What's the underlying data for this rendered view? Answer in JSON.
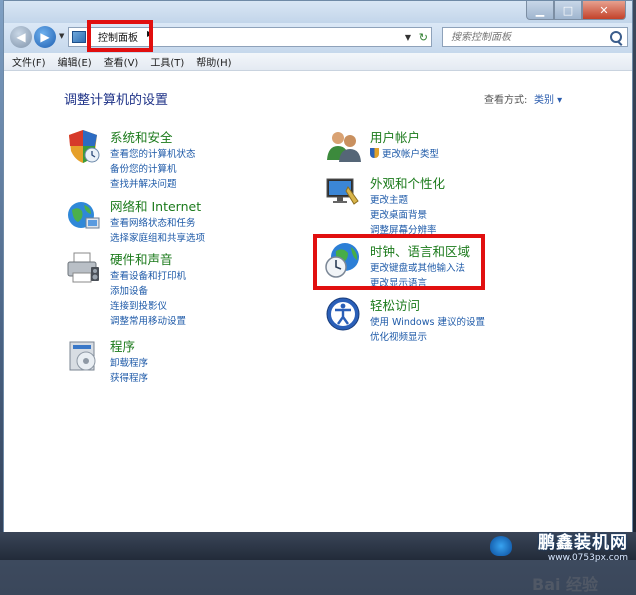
{
  "window": {
    "minimize_icon": "minimize-icon",
    "maximize_icon": "maximize-icon",
    "close_icon": "close-icon"
  },
  "navigation": {
    "breadcrumb": "控制面板",
    "search_placeholder": "搜索控制面板"
  },
  "menu": [
    "文件(F)",
    "编辑(E)",
    "查看(V)",
    "工具(T)",
    "帮助(H)"
  ],
  "content": {
    "heading": "调整计算机的设置",
    "view_by_label": "查看方式:",
    "view_by_value": "类别 ▾"
  },
  "categories_left": [
    {
      "id": "system-security",
      "title": "系统和安全",
      "icon": "shield-icon",
      "links": [
        "查看您的计算机状态",
        "备份您的计算机",
        "查找并解决问题"
      ]
    },
    {
      "id": "network-internet",
      "title": "网络和 Internet",
      "icon": "network-globe-icon",
      "links": [
        "查看网络状态和任务",
        "选择家庭组和共享选项"
      ]
    },
    {
      "id": "hardware-sound",
      "title": "硬件和声音",
      "icon": "printer-icon",
      "links": [
        "查看设备和打印机",
        "添加设备",
        "连接到投影仪",
        "调整常用移动设置"
      ]
    },
    {
      "id": "programs",
      "title": "程序",
      "icon": "programs-icon",
      "links": [
        "卸载程序",
        "获得程序"
      ]
    }
  ],
  "categories_right": [
    {
      "id": "user-accounts",
      "title": "用户帐户",
      "icon": "users-icon",
      "links": [
        "更改帐户类型"
      ]
    },
    {
      "id": "appearance",
      "title": "外观和个性化",
      "icon": "monitor-icon",
      "links": [
        "更改主题",
        "更改桌面背景",
        "调整屏幕分辨率"
      ]
    },
    {
      "id": "clock-language-region",
      "title": "时钟、语言和区域",
      "icon": "globe-clock-icon",
      "links": [
        "更改键盘或其他输入法",
        "更改显示语言"
      ]
    },
    {
      "id": "ease-of-access",
      "title": "轻松访问",
      "icon": "ease-access-icon",
      "links": [
        "使用 Windows 建议的设置",
        "优化视频显示"
      ]
    }
  ],
  "watermark": {
    "brand": "鹏鑫装机网",
    "site": "www.0753px.com",
    "baidu": "Bai 经验"
  },
  "colors": {
    "category_title": "#1b7a1b",
    "link": "#1e5aa8",
    "heading": "#1e3287",
    "highlight": "#e10f0f"
  }
}
